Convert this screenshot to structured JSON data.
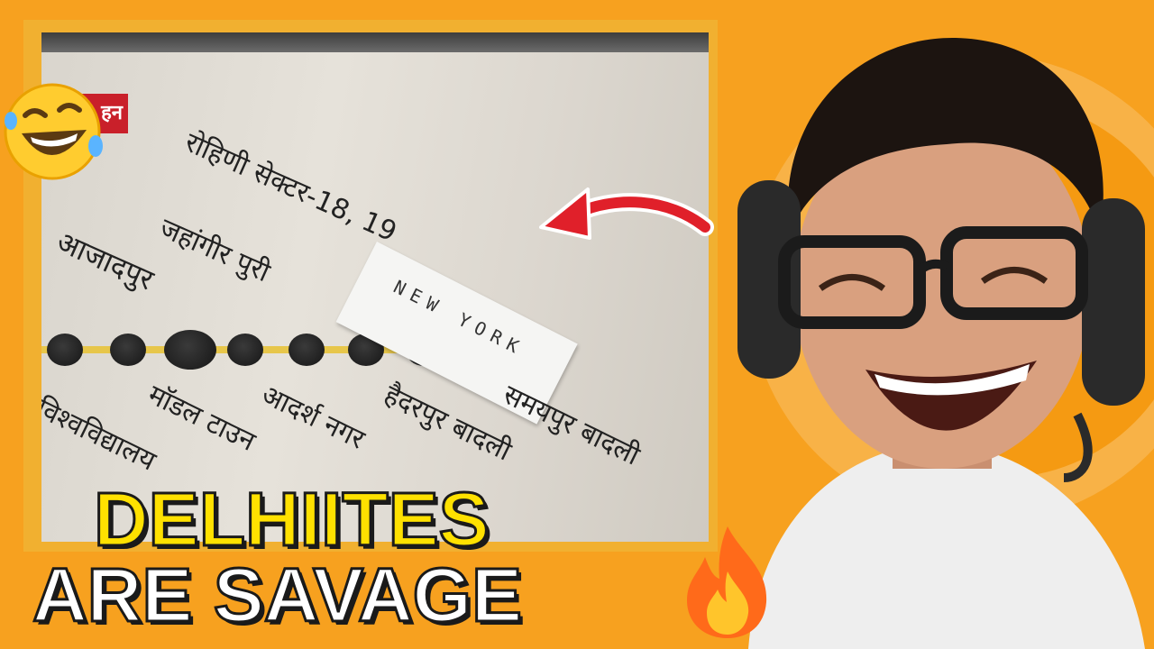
{
  "thumbnail": {
    "caption_line1": "DELHIITES",
    "caption_line2": "ARE SAVAGE",
    "caption_line1_color": "#ffe100",
    "caption_line2_color": "#ffffff",
    "background_color": "#f7a11f",
    "emoji_left": "rolling-on-floor-laughing-emoji",
    "emoji_right": "fire-emoji"
  },
  "metro_sign": {
    "tag": "हन",
    "stations_top": [
      "रोहिणी सेक्टर-18, 19",
      "जहांगीर पुरी",
      "आजादपुर"
    ],
    "stations_bottom": [
      "विश्वविद्यालय",
      "मॉडल टाउन",
      "आदर्श नगर",
      "हैदरपुर बादली",
      "समयपुर बादली"
    ],
    "sticky_note": "NEW YORK"
  }
}
